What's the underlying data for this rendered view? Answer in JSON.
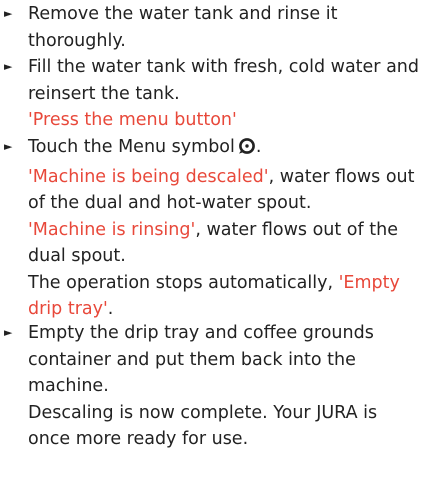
{
  "steps": [
    {
      "lines": [
        "Remove the water tank and rinse it",
        "thoroughly."
      ]
    },
    {
      "lines": [
        "Fill the water tank with fresh, cold water and",
        "reinsert the tank."
      ],
      "display_message": "'Press the menu button'"
    },
    {
      "action_text": "Touch the Menu symbol",
      "icon": "menu-symbol-icon",
      "descaling_msg": "'Machine is being descaled'",
      "descaling_rest_1": ", water flows out",
      "descaling_rest_2": "of the dual and hot-water spout.",
      "rinsing_msg": "'Machine is rinsing'",
      "rinsing_rest_1": ", water flows out of the",
      "rinsing_rest_2": "dual spout.",
      "stops_text": "The operation stops automatically,",
      "empty_msg_1": "'Empty",
      "empty_msg_2": "drip tray'",
      "period": "."
    },
    {
      "lines": [
        "Empty the drip tray and coffee grounds",
        "container and put them back into the",
        "machine.",
        "Descaling is now complete. Your JURA is",
        "once more ready for use."
      ]
    }
  ],
  "colors": {
    "text": "#222222",
    "accent": "#e8483a"
  }
}
